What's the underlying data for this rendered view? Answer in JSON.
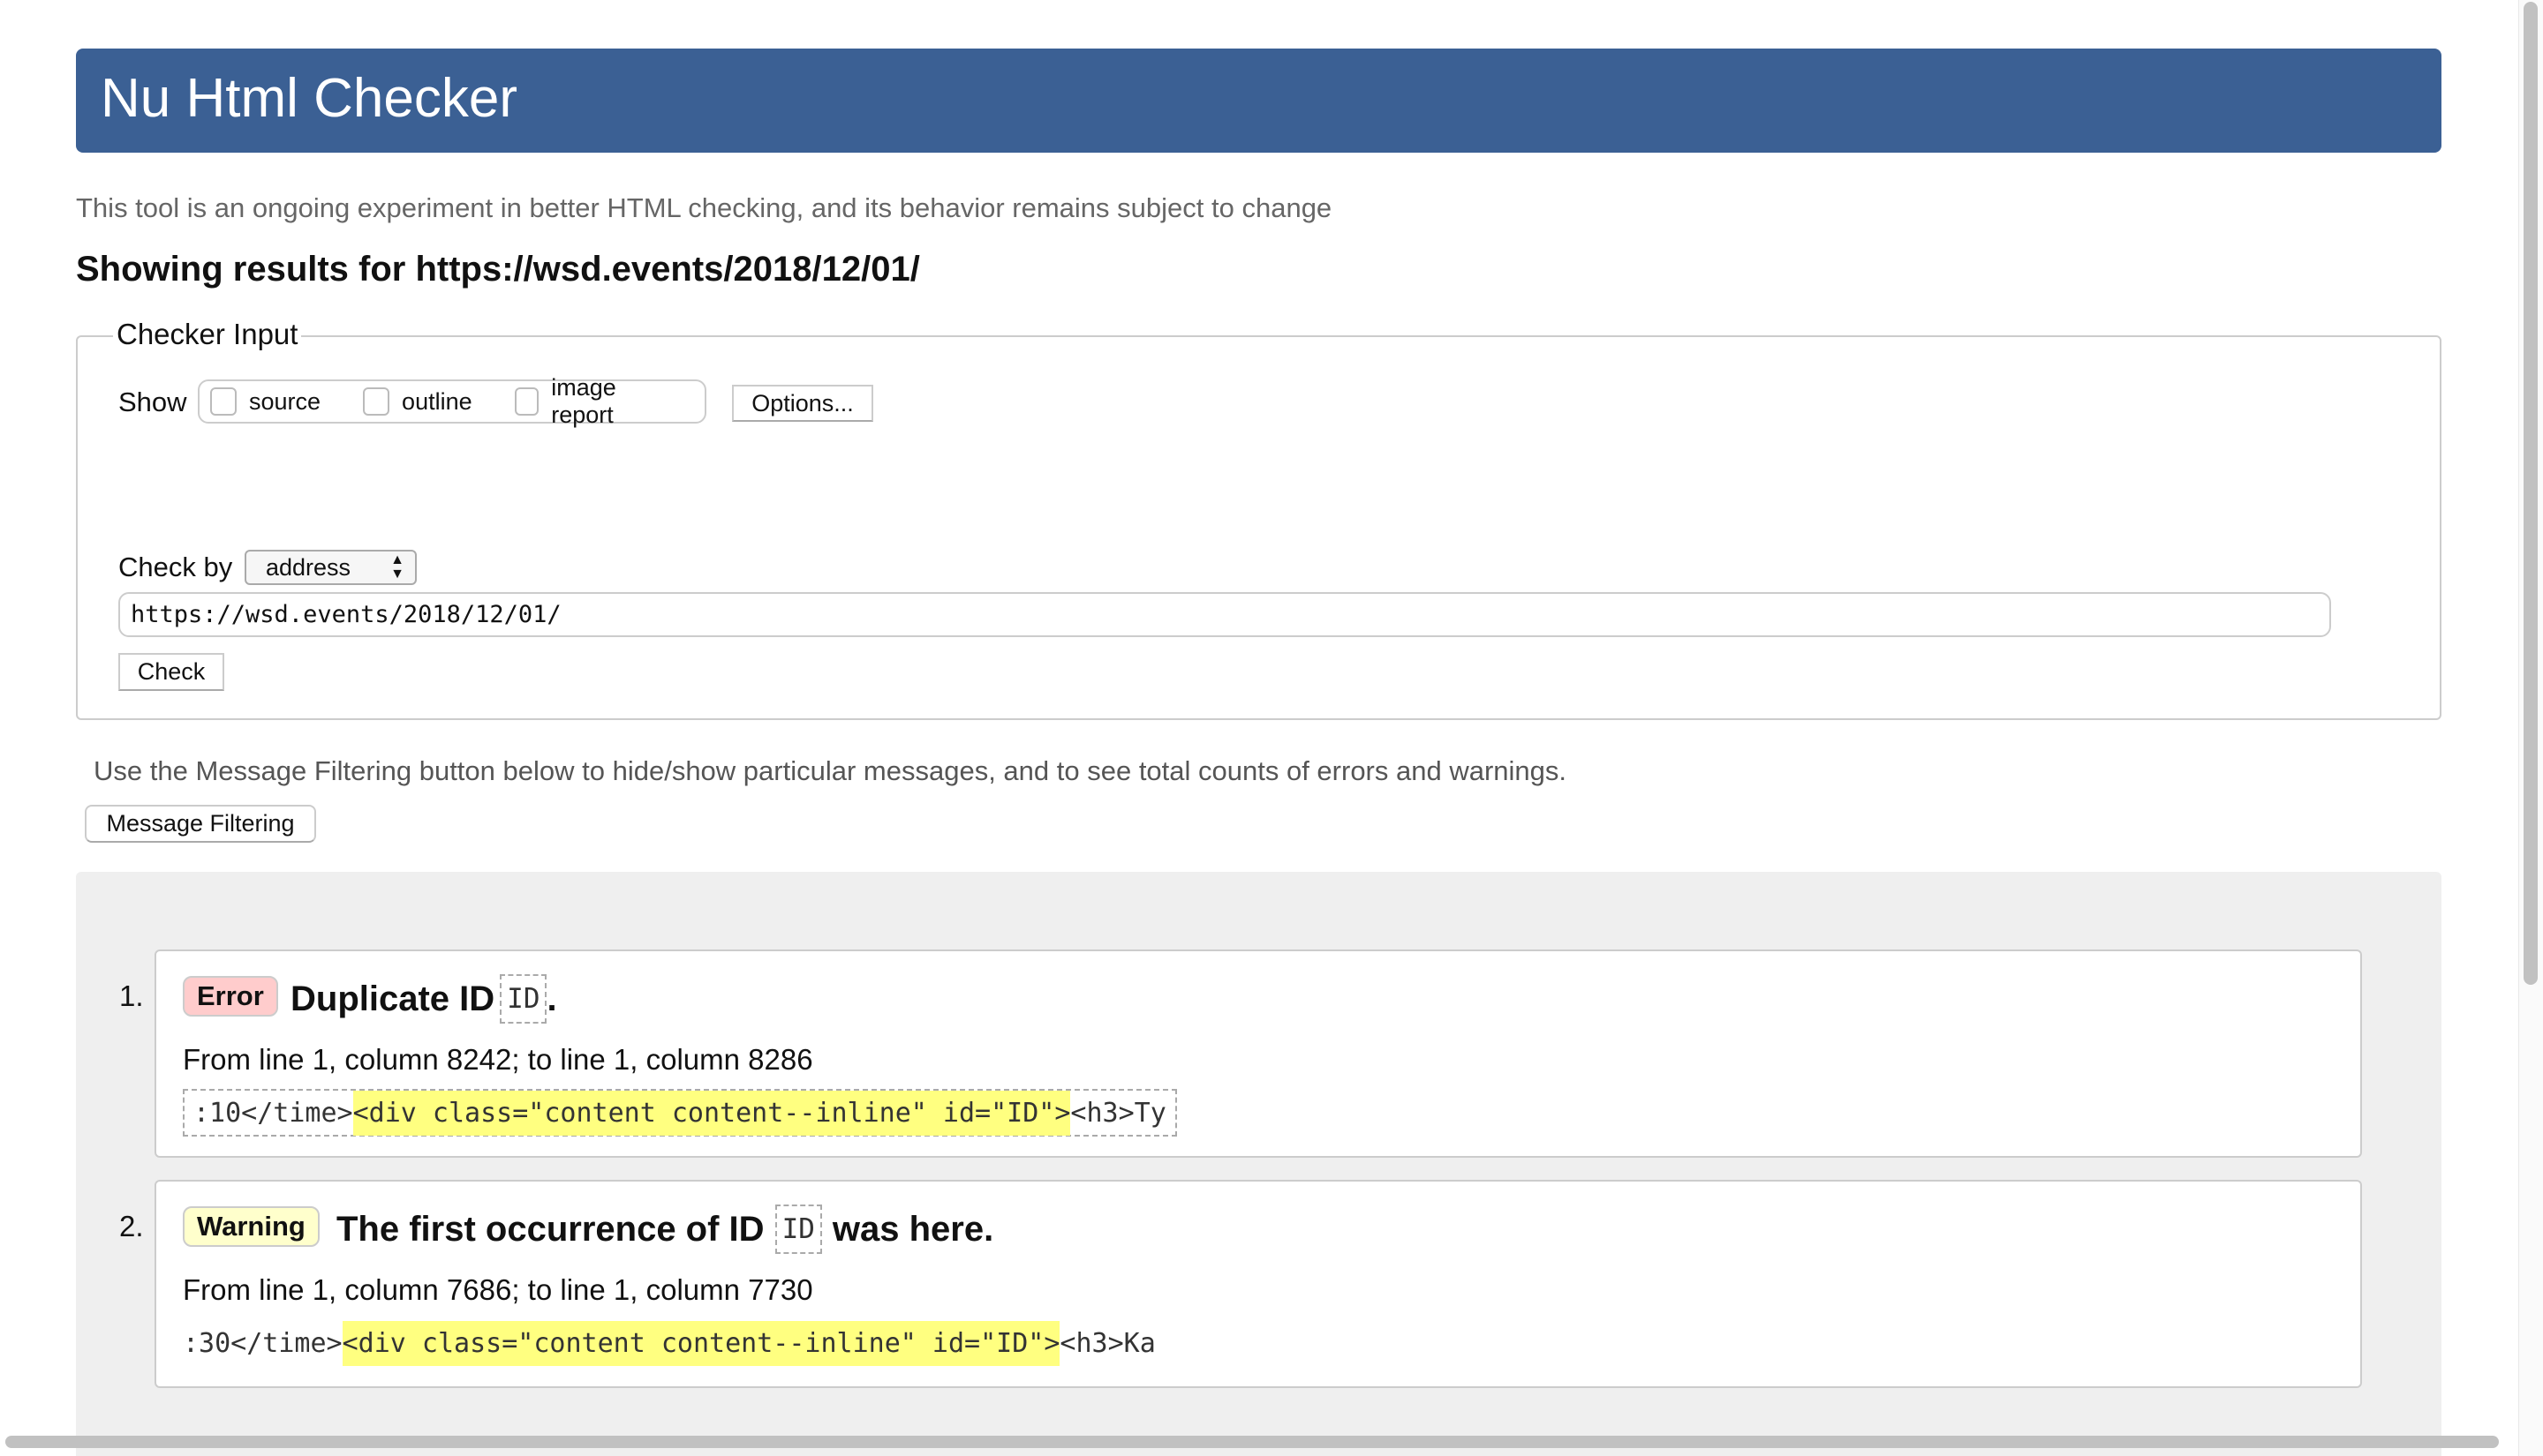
{
  "header": {
    "title": "Nu Html Checker"
  },
  "tagline": "This tool is an ongoing experiment in better HTML checking, and its behavior remains subject to change",
  "showing": "Showing results for https://wsd.events/2018/12/01/",
  "checker_input": {
    "legend": "Checker Input",
    "show_label": "Show",
    "checkboxes": [
      {
        "label": "source",
        "checked": false
      },
      {
        "label": "outline",
        "checked": false
      },
      {
        "label": "image report",
        "checked": false
      }
    ],
    "options_button": "Options...",
    "check_by_label": "Check by",
    "check_by_value": "address",
    "url_value": "https://wsd.events/2018/12/01/",
    "check_button": "Check"
  },
  "filter_text": "Use the Message Filtering button below to hide/show particular messages, and to see total counts of errors and warnings.",
  "filter_button": "Message Filtering",
  "messages": [
    {
      "number": "1.",
      "type": "Error",
      "type_color": "#ffcccc",
      "title_before": "Duplicate ID",
      "code": "ID",
      "title_after": ".",
      "location": "From line 1, column 8242; to line 1, column 8286",
      "extract_before": ":10</time>",
      "extract_highlight": "<div class=\"content content--inline\" id=\"ID\">",
      "extract_after": "<h3>Ty"
    },
    {
      "number": "2.",
      "type": "Warning",
      "type_color": "#ffffcc",
      "title_before": "The first occurrence of ID",
      "code": "ID",
      "title_after": "was here.",
      "location": "From line 1, column 7686; to line 1, column 7730",
      "extract_before": ":30</time>",
      "extract_highlight": "<div class=\"content content--inline\" id=\"ID\">",
      "extract_after": "<h3>Ka"
    }
  ],
  "colors": {
    "header": "#3b6094",
    "highlight": "#ffff80"
  }
}
